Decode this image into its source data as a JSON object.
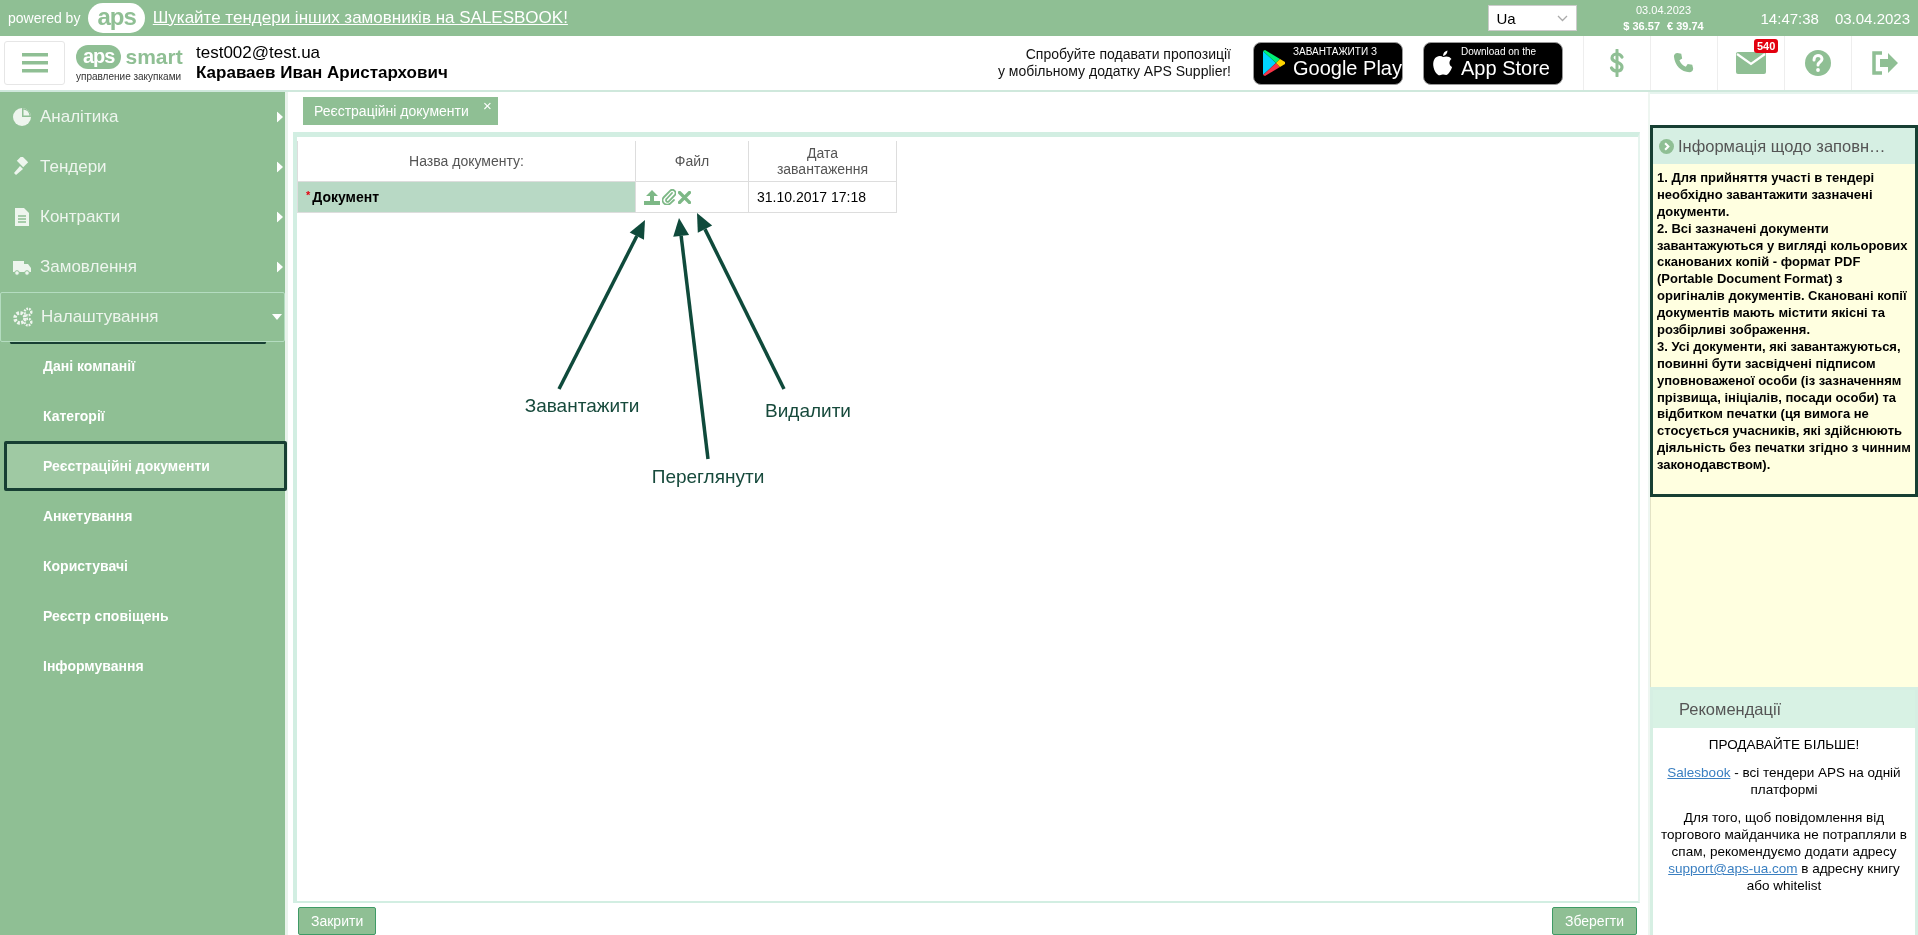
{
  "top_bar": {
    "powered_by": "powered by",
    "logo": "aps",
    "link": "Шукайте тендери інших замовників на SALESBOOK!",
    "language": "Ua",
    "rates_date": "03.04.2023",
    "usd": "$ 36.57",
    "eur": "€ 39.74",
    "time": "14:47:38",
    "date": "03.04.2023"
  },
  "header": {
    "logo_mark": "aps",
    "logo_word": "smart",
    "logo_tagline": "управление закупками",
    "email": "test002@test.ua",
    "user_name": "Караваев Иван Аристархович",
    "promo_lines": [
      "Спробуйте подавати пропозиції",
      "у мобільному додатку APS Supplier!"
    ],
    "stores": [
      {
        "caption": "ЗАВАНТАЖИТИ З",
        "name": "Google Play"
      },
      {
        "caption": "Download on the",
        "name": "App Store"
      }
    ],
    "mail_badge": "540"
  },
  "sidebar": {
    "items": [
      {
        "label": "Аналітика",
        "expanded": false
      },
      {
        "label": "Тендери",
        "expanded": false
      },
      {
        "label": "Контракти",
        "expanded": false
      },
      {
        "label": "Замовлення",
        "expanded": false
      },
      {
        "label": "Налаштування",
        "expanded": true,
        "children": [
          {
            "label": "Дані компанії",
            "selected": false
          },
          {
            "label": "Категорії",
            "selected": false
          },
          {
            "label": "Реєстраційні документи",
            "selected": true
          },
          {
            "label": "Анкетування",
            "selected": false
          },
          {
            "label": "Користувачі",
            "selected": false
          },
          {
            "label": "Реєстр сповіщень",
            "selected": false
          },
          {
            "label": "Інформування",
            "selected": false
          }
        ]
      }
    ]
  },
  "tabs": [
    {
      "label": "Реєстраційні документи",
      "selected": true,
      "close": "×"
    }
  ],
  "table": {
    "columns": [
      "Назва документу:",
      "Файл",
      "Дата завантаження"
    ],
    "rows": [
      {
        "required_mark": "*",
        "name": "Документ",
        "date": "31.10.2017 17:18"
      }
    ]
  },
  "annotations": [
    {
      "label": "Завантажити"
    },
    {
      "label": "Переглянути"
    },
    {
      "label": "Видалити"
    }
  ],
  "buttons": [
    "Закрити",
    "Зберегти"
  ],
  "info_panel": {
    "title": "Інформація щодо заповн…",
    "paragraphs": [
      "1. Для прийняття участі в тендері необхідно завантажити зазначені документи.",
      "2. Всі зазначені документи завантажуються у вигляді кольорових сканованих копій - формат PDF (Portable Document Format) з оригіналів документів. Скановані копії документів мають містити якісні та розбірливі зображення.",
      "3. Усі документи, які завантажуються, повинні бути засвідчені підписом уповноваженої особи (із зазначенням прізвища, ініціалів, посади особи) та відбитком печатки (ця вимога не стосується учасників, які здійснюють діяльність без печатки згідно з чинним законодавством)."
    ]
  },
  "recommendations": {
    "title": "Рекомендації",
    "headline": "ПРОДАВАЙТЕ БІЛЬШЕ!",
    "promo": {
      "link": "Salesbook",
      "after": " - всі тендери APS на одній платформі"
    },
    "notice": {
      "before": "Для того, щоб повідомлення від торгового майданчика не потрапляли в спам, рекомендуємо додати адресу ",
      "link": "support@aps-ua.com",
      "after": " в адресну книгу або whitelist"
    }
  }
}
